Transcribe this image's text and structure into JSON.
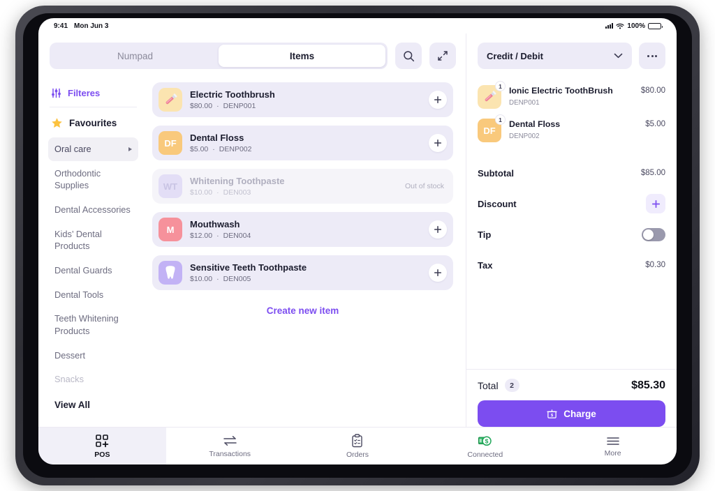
{
  "status_bar": {
    "time": "9:41",
    "date": "Mon Jun 3",
    "battery": "100%",
    "signal_icon": "cellular-signal-icon",
    "wifi_icon": "wifi-icon",
    "battery_icon": "battery-full-icon"
  },
  "top_bar": {
    "tabs": [
      {
        "label": "Numpad",
        "active": false
      },
      {
        "label": "Items",
        "active": true
      }
    ],
    "search_icon": "search-icon",
    "expand_icon": "expand-icon",
    "payment_method": "Credit / Debit",
    "payment_caret_icon": "chevron-down-icon",
    "more_icon": "more-horizontal-icon"
  },
  "sidebar": {
    "filters_label": "Filteres",
    "filters_icon": "filter-sliders-icon",
    "favourites_label": "Favourites",
    "favourites_icon": "star-icon",
    "categories": [
      {
        "label": "Oral care",
        "active": true,
        "has_caret": true,
        "dim": false
      },
      {
        "label": "Orthodontic Supplies",
        "active": false,
        "has_caret": false,
        "dim": false
      },
      {
        "label": "Dental Accessories",
        "active": false,
        "has_caret": false,
        "dim": false
      },
      {
        "label": "Kids’ Dental Products",
        "active": false,
        "has_caret": false,
        "dim": false
      },
      {
        "label": "Dental Guards",
        "active": false,
        "has_caret": false,
        "dim": false
      },
      {
        "label": "Dental Tools",
        "active": false,
        "has_caret": false,
        "dim": false
      },
      {
        "label": "Teeth Whitening Products",
        "active": false,
        "has_caret": false,
        "dim": false
      },
      {
        "label": "Dessert",
        "active": false,
        "has_caret": false,
        "dim": false
      },
      {
        "label": "Snacks",
        "active": false,
        "has_caret": false,
        "dim": true
      }
    ],
    "view_all_label": "View All"
  },
  "items": [
    {
      "name": "Electric Toothbrush",
      "price": "$80.00",
      "sku": "DENP001",
      "separator": "·",
      "thumb_kind": "image-toothbrush",
      "thumb_initials": "",
      "thumb_bg": "#fbe4b0",
      "out_of_stock": false,
      "add_icon": "plus-icon"
    },
    {
      "name": "Dental Floss",
      "price": "$5.00",
      "sku": "DENP002",
      "separator": "·",
      "thumb_kind": "initials",
      "thumb_initials": "DF",
      "thumb_bg": "#f9c97c",
      "out_of_stock": false,
      "add_icon": "plus-icon"
    },
    {
      "name": "Whitening Toothpaste",
      "price": "$10.00",
      "sku": "DEN003",
      "separator": "·",
      "thumb_kind": "initials",
      "thumb_initials": "WT",
      "thumb_bg": "#e3def6",
      "out_of_stock": true,
      "out_of_stock_label": "Out of stock",
      "add_icon": ""
    },
    {
      "name": "Mouthwash",
      "price": "$12.00",
      "sku": "DEN004",
      "separator": "·",
      "thumb_kind": "initials",
      "thumb_initials": "M",
      "thumb_bg": "#f6919b",
      "out_of_stock": false,
      "add_icon": "plus-icon"
    },
    {
      "name": "Sensitive Teeth Toothpaste",
      "price": "$10.00",
      "sku": "DEN005",
      "separator": "·",
      "thumb_kind": "image-tooth",
      "thumb_initials": "",
      "thumb_bg": "#c2b2f5",
      "out_of_stock": false,
      "add_icon": "plus-icon"
    }
  ],
  "create_new_item_label": "Create new item",
  "cart": {
    "lines": [
      {
        "name": "Ionic Electric ToothBrush",
        "sku": "DENP001",
        "price": "$80.00",
        "qty": "1",
        "thumb_kind": "image-toothbrush",
        "thumb_initials": "",
        "thumb_bg": "#fbe4b0"
      },
      {
        "name": "Dental Floss",
        "sku": "DENP002",
        "price": "$5.00",
        "qty": "1",
        "thumb_kind": "initials",
        "thumb_initials": "DF",
        "thumb_bg": "#f9c97c"
      }
    ],
    "subtotal_label": "Subtotal",
    "subtotal_value": "$85.00",
    "discount_label": "Discount",
    "discount_add_icon": "plus-icon",
    "tip_label": "Tip",
    "tip_enabled": false,
    "tax_label": "Tax",
    "tax_value": "$0.30",
    "total_label": "Total",
    "total_count": "2",
    "total_amount": "$85.30",
    "charge_label": "Charge",
    "charge_icon": "cash-register-icon"
  },
  "bottom_nav": [
    {
      "label": "POS",
      "icon": "pos-grid-plus-icon",
      "active": true
    },
    {
      "label": "Transactions",
      "icon": "transfer-arrows-icon",
      "active": false
    },
    {
      "label": "Orders",
      "icon": "clipboard-list-icon",
      "active": false
    },
    {
      "label": "Connected",
      "icon": "cash-connected-icon",
      "active": false
    },
    {
      "label": "More",
      "icon": "hamburger-menu-icon",
      "active": false
    }
  ],
  "colors": {
    "accent": "#7c4df0",
    "surface": "#edebf7",
    "text": "#1b1c2e",
    "muted": "#6d6c80",
    "connected_green": "#21a75a"
  }
}
